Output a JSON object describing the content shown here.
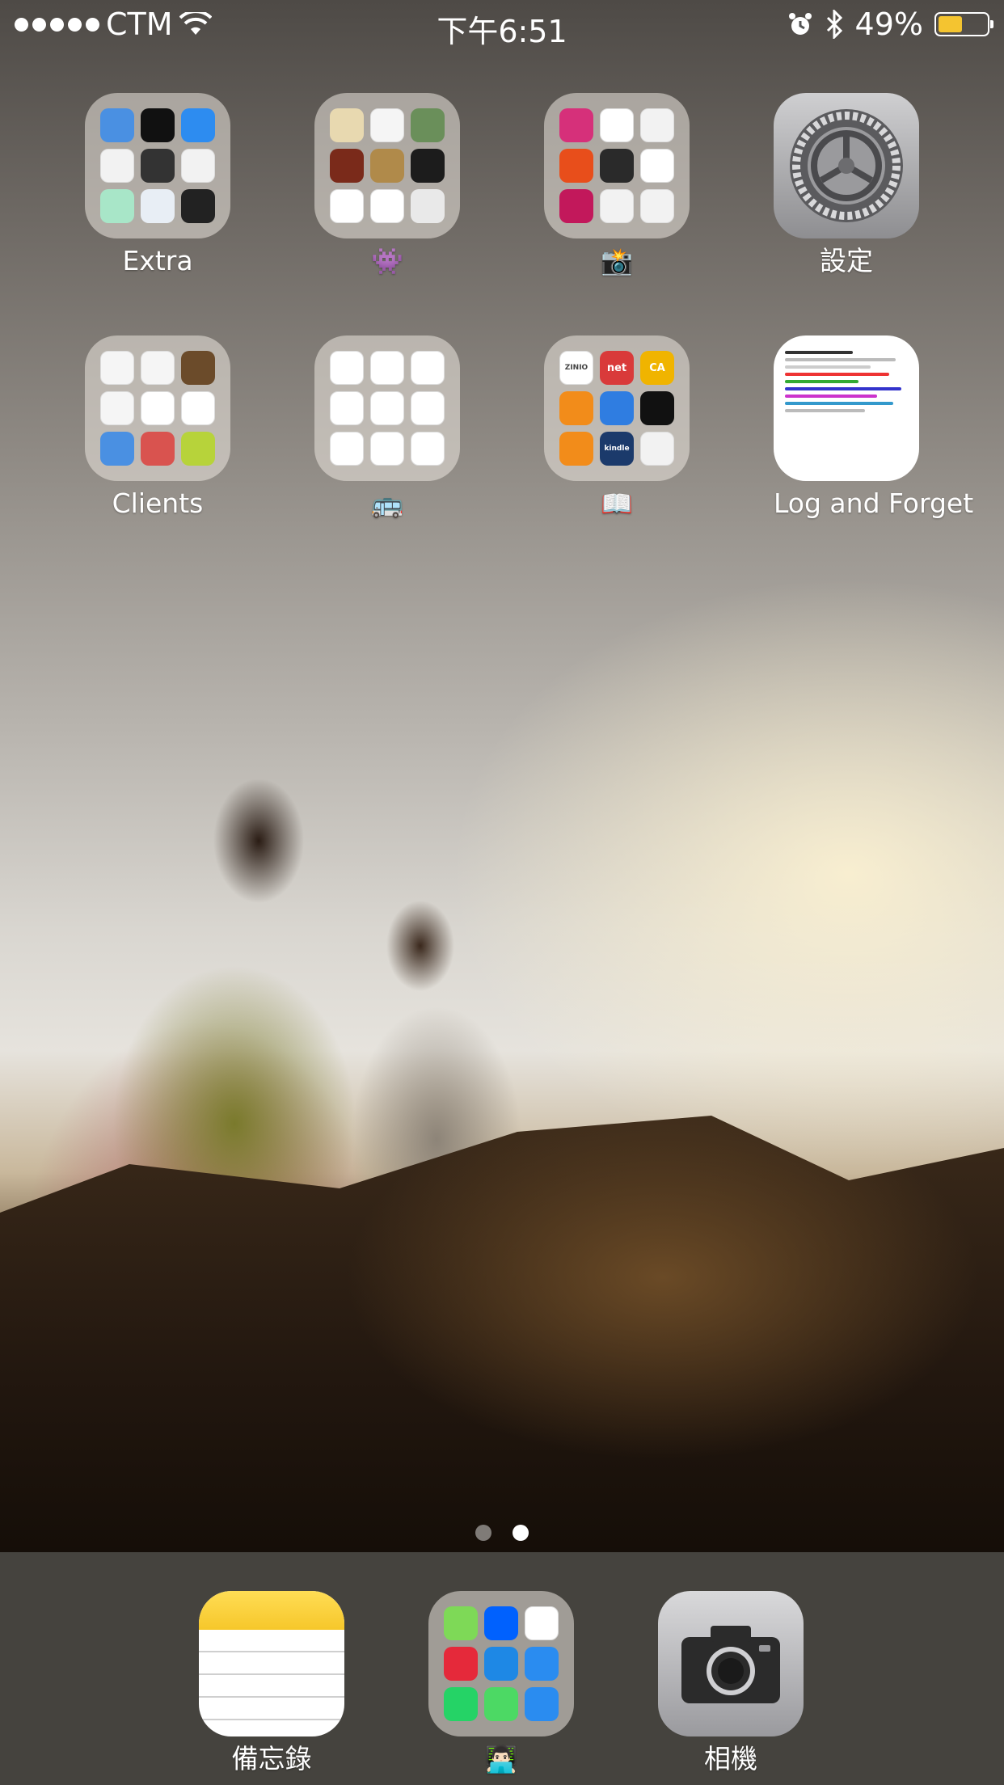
{
  "status_bar": {
    "carrier": "CTM",
    "time": "下午6:51",
    "battery_percent": "49%",
    "battery_level": 0.49
  },
  "home": {
    "row1": [
      {
        "name": "Extra",
        "type": "folder"
      },
      {
        "name": "👾",
        "type": "folder"
      },
      {
        "name": "📸",
        "type": "folder"
      },
      {
        "name": "設定",
        "type": "app",
        "icon": "gear-icon"
      }
    ],
    "row2": [
      {
        "name": "Clients",
        "type": "folder"
      },
      {
        "name": "🚌",
        "type": "folder"
      },
      {
        "name": "📖",
        "type": "folder"
      },
      {
        "name": "Log and Forget",
        "type": "app"
      }
    ],
    "folder_minis": {
      "extra": [
        "#4a90e2",
        "#111111",
        "#2d8cf0",
        "#f2f2f2",
        "#333333",
        "#f2f2f2",
        "#a8e6c8",
        "#e8eef5",
        "#222222"
      ],
      "games": [
        "#e8d9b0",
        "#f5f5f5",
        "#6a8f5a",
        "#7a2a1a",
        "#b08a4a",
        "#1c1c1c",
        "#ffffff",
        "#ffffff",
        "#e9e9e9"
      ],
      "camera": [
        "#d6307a",
        "#ffffff",
        "#f2f2f2",
        "#e84e1b",
        "#2a2a2a",
        "#ffffff",
        "#c2185b",
        "#f2f2f2",
        "#f2f2f2"
      ],
      "clients": [
        "#f5f5f5",
        "#f5f5f5",
        "#6b4b2a",
        "#f5f5f5",
        "#ffffff",
        "#ffffff",
        "#4a90e2",
        "#d9534f",
        "#b7d33a"
      ],
      "bus": [
        "#ffffff",
        "#ffffff",
        "#ffffff",
        "#ffffff",
        "#ffffff",
        "#ffffff",
        "#ffffff",
        "#ffffff",
        "#ffffff"
      ],
      "books": [
        "#ffffff",
        "#d93a3a",
        "#f0b400",
        "#f28c1a",
        "#2f7de1",
        "#111111",
        "#f28c1a",
        "#1b3a6b",
        "#f2f2f2"
      ]
    },
    "folder_mini_labels": {
      "books": [
        "ZINIO",
        "net",
        "CA",
        "",
        "",
        "",
        "",
        "kindle",
        ""
      ]
    }
  },
  "pages": {
    "count": 2,
    "current_index": 1
  },
  "dock": [
    {
      "name": "備忘錄",
      "type": "app",
      "icon": "notes-icon"
    },
    {
      "name": "👨🏻‍💻",
      "type": "folder"
    },
    {
      "name": "相機",
      "type": "app",
      "icon": "camera-icon"
    }
  ],
  "dock_folder_minis": [
    "#7ed957",
    "#0061fe",
    "#ffffff",
    "#e5293a",
    "#1e88e5",
    "#2a8cf0",
    "#25d366",
    "#4cd964",
    "#2a8cf0"
  ],
  "colors": {
    "battery": "#f4c430",
    "dot_active": "#ffffff",
    "dot_inactive": "rgba(255,255,255,0.45)"
  }
}
